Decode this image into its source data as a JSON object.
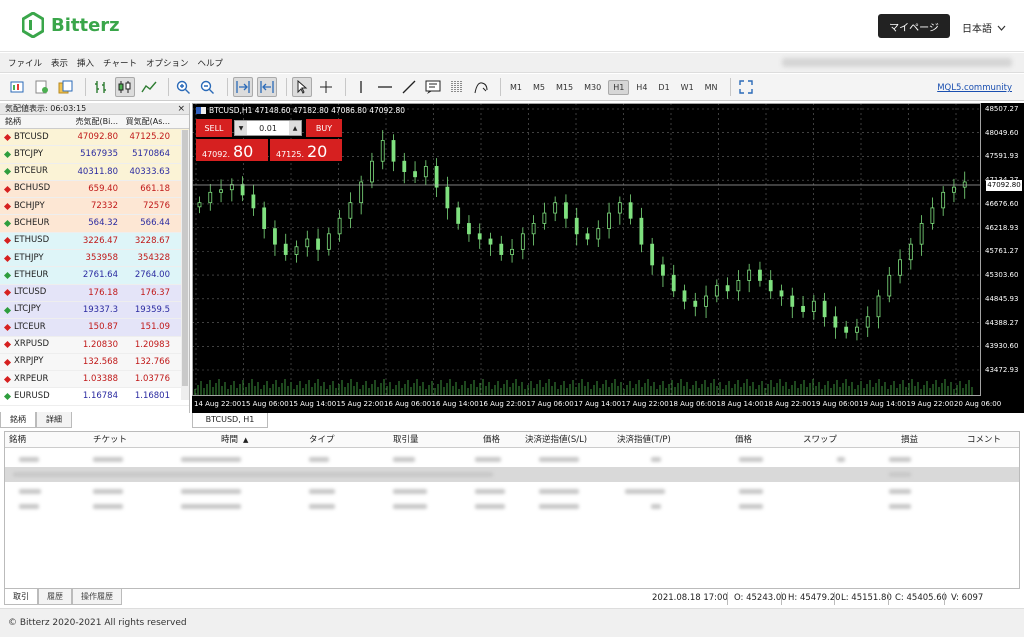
{
  "header": {
    "logo_text": "Bitterz",
    "mypage_label": "マイページ",
    "language": "日本語"
  },
  "menu": [
    "ファイル",
    "表示",
    "挿入",
    "チャート",
    "オプション",
    "ヘルプ"
  ],
  "toolbar": {
    "timeframes": [
      "M1",
      "M5",
      "M15",
      "M30",
      "H1",
      "H4",
      "D1",
      "W1",
      "MN"
    ],
    "active_timeframe": "H1",
    "mql5_link": "MQL5.community"
  },
  "market_watch": {
    "title": "気配値表示: 06:03:15",
    "col_symbol": "銘柄",
    "col_bid": "売気配(Bi...",
    "col_ask": "買気配(As...",
    "rows": [
      {
        "symbol": "BTCUSD",
        "bid": "47092.80",
        "ask": "47125.20",
        "dir": "down",
        "group": "btc"
      },
      {
        "symbol": "BTCJPY",
        "bid": "5167935",
        "ask": "5170864",
        "dir": "up",
        "group": "btc"
      },
      {
        "symbol": "BTCEUR",
        "bid": "40311.80",
        "ask": "40333.63",
        "dir": "up",
        "group": "btc"
      },
      {
        "symbol": "BCHUSD",
        "bid": "659.40",
        "ask": "661.18",
        "dir": "down",
        "group": "bch"
      },
      {
        "symbol": "BCHJPY",
        "bid": "72332",
        "ask": "72576",
        "dir": "down",
        "group": "bch"
      },
      {
        "symbol": "BCHEUR",
        "bid": "564.32",
        "ask": "566.44",
        "dir": "up",
        "group": "bch"
      },
      {
        "symbol": "ETHUSD",
        "bid": "3226.47",
        "ask": "3228.67",
        "dir": "down",
        "group": "eth"
      },
      {
        "symbol": "ETHJPY",
        "bid": "353958",
        "ask": "354328",
        "dir": "down",
        "group": "eth"
      },
      {
        "symbol": "ETHEUR",
        "bid": "2761.64",
        "ask": "2764.00",
        "dir": "up",
        "group": "eth"
      },
      {
        "symbol": "LTCUSD",
        "bid": "176.18",
        "ask": "176.37",
        "dir": "down",
        "group": "ltc"
      },
      {
        "symbol": "LTCJPY",
        "bid": "19337.3",
        "ask": "19359.5",
        "dir": "up",
        "group": "ltc"
      },
      {
        "symbol": "LTCEUR",
        "bid": "150.87",
        "ask": "151.09",
        "dir": "down",
        "group": "ltc"
      },
      {
        "symbol": "XRPUSD",
        "bid": "1.20830",
        "ask": "1.20983",
        "dir": "down",
        "group": "xrp"
      },
      {
        "symbol": "XRPJPY",
        "bid": "132.568",
        "ask": "132.766",
        "dir": "down",
        "group": "xrp"
      },
      {
        "symbol": "XRPEUR",
        "bid": "1.03388",
        "ask": "1.03776",
        "dir": "down",
        "group": "xrp"
      },
      {
        "symbol": "EURUSD",
        "bid": "1.16784",
        "ask": "1.16801",
        "dir": "up",
        "group": "fx"
      }
    ],
    "tabs": [
      "銘柄",
      "詳細"
    ]
  },
  "chart": {
    "info": "BTCUSD,H1  47148.60 47182.80 47086.80 47092.80",
    "sell_label": "SELL",
    "buy_label": "BUY",
    "lot": "0.01",
    "sell_small": "47092.",
    "sell_big": "80",
    "buy_small": "47125.",
    "buy_big": "20",
    "current_price": "47092.80",
    "y_ticks": [
      "48507.27",
      "48049.60",
      "47591.93",
      "47134.27",
      "46676.60",
      "46218.93",
      "45761.27",
      "45303.60",
      "44845.93",
      "44388.27",
      "43930.60",
      "43472.93"
    ],
    "x_ticks": [
      "14 Aug 22:00",
      "15 Aug 06:00",
      "15 Aug 14:00",
      "15 Aug 22:00",
      "16 Aug 06:00",
      "16 Aug 14:00",
      "16 Aug 22:00",
      "17 Aug 06:00",
      "17 Aug 14:00",
      "17 Aug 22:00",
      "18 Aug 06:00",
      "18 Aug 14:00",
      "18 Aug 22:00",
      "19 Aug 06:00",
      "19 Aug 14:00",
      "19 Aug 22:00",
      "20 Aug 06:00"
    ],
    "tab": "BTCUSD, H1"
  },
  "terminal": {
    "columns": [
      "銘柄",
      "チケット",
      "時間",
      "タイプ",
      "取引量",
      "価格",
      "決済逆指値(S/L)",
      "決済指値(T/P)",
      "価格",
      "スワップ",
      "損益",
      "コメント"
    ],
    "tabs": [
      "取引",
      "履歴",
      "操作履歴"
    ]
  },
  "status": {
    "datetime": "2021.08.18 17:00",
    "open": "O: 45243.00",
    "high": "H: 45479.20",
    "low": "L: 45151.80",
    "close": "C: 45405.60",
    "volume": "V: 6097"
  },
  "footer": "© Bitterz 2020-2021 All rights reserved",
  "colors": {
    "brand": "#3aa64a",
    "bid_up": "#2a2aa0",
    "ask_down": "#c01818",
    "candle": "#7fe07f"
  }
}
